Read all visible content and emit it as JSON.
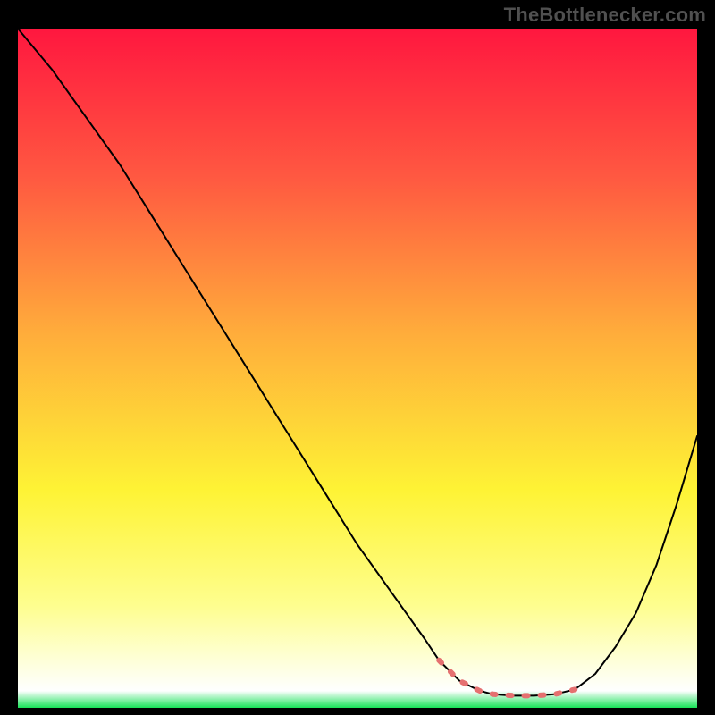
{
  "watermark": "TheBottlenecker.com",
  "chart_data": {
    "type": "line",
    "title": "",
    "xlabel": "",
    "ylabel": "",
    "xlim": [
      0,
      100
    ],
    "ylim": [
      0,
      100
    ],
    "grid": false,
    "note": "x runs 0→100 across the plot width; y is 0 at the bottom (green band) and 100 at the top (red). The thin black curve descends from the top-left, reaches a flat minimum near x≈70–80, and rises toward the right. The salmon dashed segment traces the curve through the low flat region. Values are eyeballed from gridless pixels.",
    "gradient_stops": [
      {
        "offset": 0.0,
        "color": "#ff173f"
      },
      {
        "offset": 0.22,
        "color": "#ff5941"
      },
      {
        "offset": 0.45,
        "color": "#ffad3b"
      },
      {
        "offset": 0.68,
        "color": "#fef335"
      },
      {
        "offset": 0.85,
        "color": "#fefe8f"
      },
      {
        "offset": 0.93,
        "color": "#feffd8"
      },
      {
        "offset": 0.975,
        "color": "#feffff"
      },
      {
        "offset": 1.0,
        "color": "#18e258"
      }
    ],
    "series": [
      {
        "name": "bottleneck-curve",
        "color": "#000000",
        "width": 2,
        "x": [
          0,
          5,
          10,
          15,
          20,
          25,
          30,
          35,
          40,
          45,
          50,
          55,
          60,
          62,
          65,
          68,
          70,
          73,
          76,
          79,
          82,
          85,
          88,
          91,
          94,
          97,
          100
        ],
        "y": [
          100,
          94,
          87,
          80,
          72,
          64,
          56,
          48,
          40,
          32,
          24,
          17,
          10,
          7,
          4,
          2.5,
          2,
          1.8,
          1.8,
          2,
          2.7,
          5,
          9,
          14,
          21,
          30,
          40
        ]
      },
      {
        "name": "optimal-zone",
        "color": "#e57070",
        "width": 6,
        "dashed": true,
        "x": [
          62,
          65,
          68,
          70,
          73,
          76,
          79,
          82
        ],
        "y": [
          7,
          4,
          2.5,
          2,
          1.8,
          1.8,
          2,
          2.7
        ]
      }
    ]
  }
}
